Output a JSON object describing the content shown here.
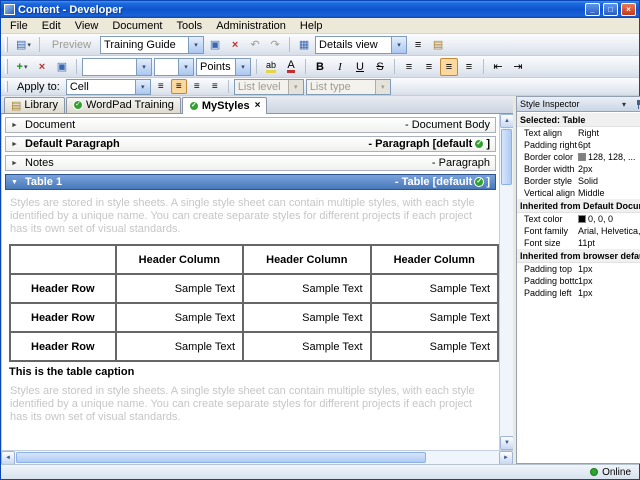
{
  "colors": {
    "selected_section": "#4878B8",
    "table_header_bg": "#FAF8C8",
    "check_green": "#33A033",
    "online_green": "#2FA52F"
  },
  "window": {
    "title": "Content - Developer",
    "status_online": "Online"
  },
  "window_controls": {
    "minimize": "_",
    "maximize": "□",
    "close": "×"
  },
  "menu": {
    "items": [
      "File",
      "Edit",
      "View",
      "Document",
      "Tools",
      "Administration",
      "Help"
    ]
  },
  "icons": {
    "new_doc": "▤",
    "dropdown": "▾",
    "save": "▣",
    "delete": "×",
    "add": "+",
    "undo": "↶",
    "redo": "↷",
    "details_view": "▦",
    "list_view": "≡",
    "font_color": "A",
    "highlight": "ab",
    "bold": "B",
    "italic": "I",
    "underline": "U",
    "strikethrough": "S",
    "align": "≡",
    "indent_left": "⇤",
    "indent_right": "⇥",
    "check": "✓",
    "close": "×",
    "library": "▤",
    "arrow_collapsed": "►",
    "arrow_expanded": "▼",
    "scroll_up": "▲",
    "scroll_down": "▼",
    "scroll_left": "◄",
    "scroll_right": "►"
  },
  "toolbar1": {
    "preview_label": "Preview",
    "guide_combo": "Training Guide",
    "view_combo": "Details view"
  },
  "toolbar2": {
    "font_combo": "",
    "size_combo": "",
    "points_combo": "Points"
  },
  "toolbar3": {
    "apply_label": "Apply to:",
    "apply_combo": "Cell",
    "list_level_combo": "List level",
    "list_type_combo": "List type"
  },
  "tabs": [
    {
      "label": "Library"
    },
    {
      "label": "WordPad Training"
    },
    {
      "label": "MyStyles"
    }
  ],
  "sections": [
    {
      "title": "Document",
      "type_prefix": "- Document Body",
      "type_suffix": ""
    },
    {
      "title": "Default Paragraph",
      "type_prefix": "- Paragraph [default",
      "type_suffix": "]"
    },
    {
      "title": "Notes",
      "type_prefix": "- Paragraph",
      "type_suffix": ""
    },
    {
      "title": "Table 1",
      "type_prefix": "- Table [default",
      "type_suffix": "]"
    }
  ],
  "content": {
    "placeholder_text": "Styles are stored in style sheets. A single style sheet can contain multiple styles, with each style identified by a unique name. You can create separate styles for different projects if each project has its own set of visual standards.",
    "table": {
      "rows": [
        [
          "",
          "Header Column",
          "Header Column",
          "Header Column"
        ],
        [
          "Header Row",
          "Sample Text",
          "Sample Text",
          "Sample Text"
        ],
        [
          "Header Row",
          "Sample Text",
          "Sample Text",
          "Sample Text"
        ],
        [
          "Header Row",
          "Sample Text",
          "Sample Text",
          "Sample Text"
        ]
      ],
      "caption": "This is the table caption"
    }
  },
  "inspector": {
    "title": "Style Inspector",
    "groups": [
      {
        "header": "Selected: Table",
        "rows": [
          {
            "label": "Text align",
            "value": "Right"
          },
          {
            "label": "Padding right",
            "value": "6pt"
          },
          {
            "label": "Border color",
            "value": "128, 128, ...",
            "swatch": "#808080"
          },
          {
            "label": "Border width",
            "value": "2px"
          },
          {
            "label": "Border style",
            "value": "Solid"
          },
          {
            "label": "Vertical align",
            "value": "Middle"
          }
        ]
      },
      {
        "header": "Inherited from Default Document",
        "rows": [
          {
            "label": "Text color",
            "value": "0, 0, 0",
            "swatch": "#000000"
          },
          {
            "label": "Font family",
            "value": "Arial, Helvetica, ..."
          },
          {
            "label": "Font size",
            "value": "11pt"
          }
        ]
      },
      {
        "header": "Inherited from browser defaults",
        "rows": [
          {
            "label": "Padding top",
            "value": "1px"
          },
          {
            "label": "Padding bottom",
            "value": "1px"
          },
          {
            "label": "Padding left",
            "value": "1px"
          }
        ]
      }
    ]
  }
}
